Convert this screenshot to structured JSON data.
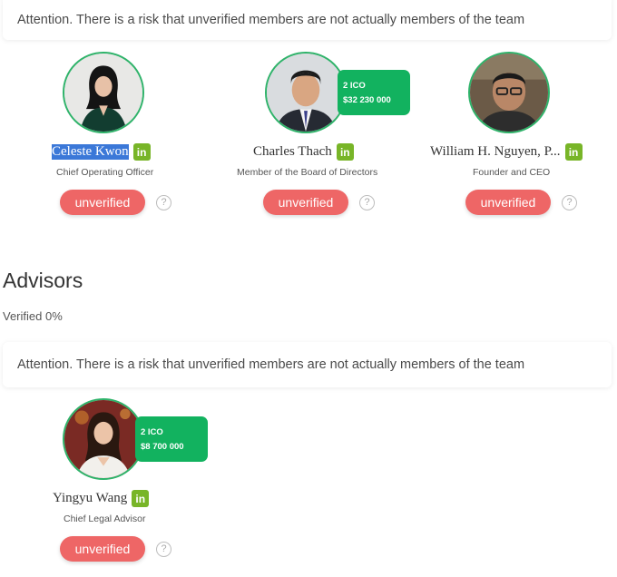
{
  "team_notice": "Attention. There is a risk that unverified members are not actually members of the team",
  "team": [
    {
      "name": "Celeste Kwon",
      "role": "Chief Operating Officer",
      "status": "unverified",
      "linkedin": "in",
      "help": "?"
    },
    {
      "name": "Charles Thach",
      "role": "Member of the Board of Directors",
      "status": "unverified",
      "linkedin": "in",
      "help": "?",
      "ico_count": "2 ICO",
      "ico_amount": "$32 230 000"
    },
    {
      "name": "William H. Nguyen, P...",
      "role": "Founder and CEO",
      "status": "unverified",
      "linkedin": "in",
      "help": "?"
    }
  ],
  "advisors": {
    "title": "Advisors",
    "verified": "Verified 0%",
    "notice": "Attention. There is a risk that unverified members are not actually members of the team",
    "members": [
      {
        "name": "Yingyu Wang",
        "role": "Chief Legal Advisor",
        "status": "unverified",
        "linkedin": "in",
        "help": "?",
        "ico_count": "2 ICO",
        "ico_amount": "$8 700 000"
      }
    ]
  },
  "colors": {
    "accent_green": "#12b25f",
    "avatar_border": "#2fb36a",
    "linkedin": "#78b528",
    "unverified": "#ee6666",
    "selection": "#3b78d8"
  }
}
